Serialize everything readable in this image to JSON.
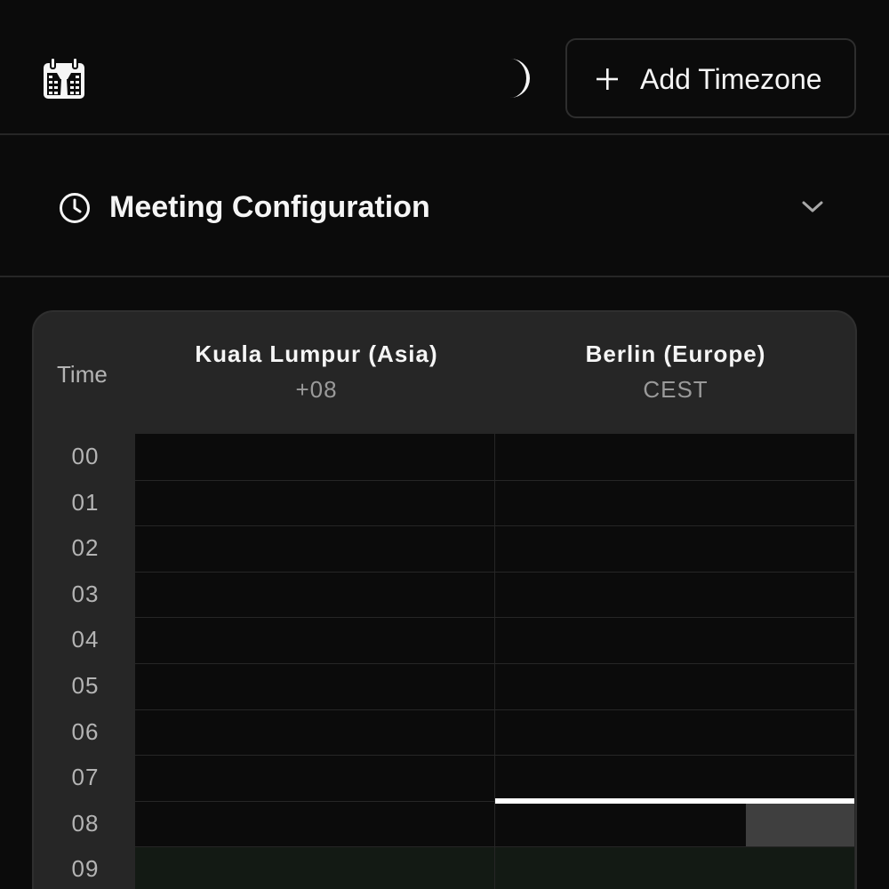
{
  "header": {
    "logo_icon": "calendar-logo-icon",
    "theme_icon": "moon-icon",
    "add_button_label": "Add Timezone",
    "add_button_icon": "plus-icon"
  },
  "config": {
    "title": "Meeting Configuration",
    "icon": "clock-icon",
    "toggle_icon": "chevron-down-icon"
  },
  "table": {
    "time_header": "Time",
    "timezones": [
      {
        "name": "Kuala Lumpur (Asia)",
        "abbr": "+08"
      },
      {
        "name": "Berlin (Europe)",
        "abbr": "CEST"
      }
    ],
    "hours": [
      "00",
      "01",
      "02",
      "03",
      "04",
      "05",
      "06",
      "07",
      "08",
      "09"
    ],
    "working_hours_start": "09",
    "current_time_hour": "08"
  },
  "colors": {
    "background": "#0b0b0b",
    "card": "#262626",
    "working_cell": "#131a14",
    "current_time_line": "#ffffff",
    "current_block": "#3f3f3f"
  }
}
